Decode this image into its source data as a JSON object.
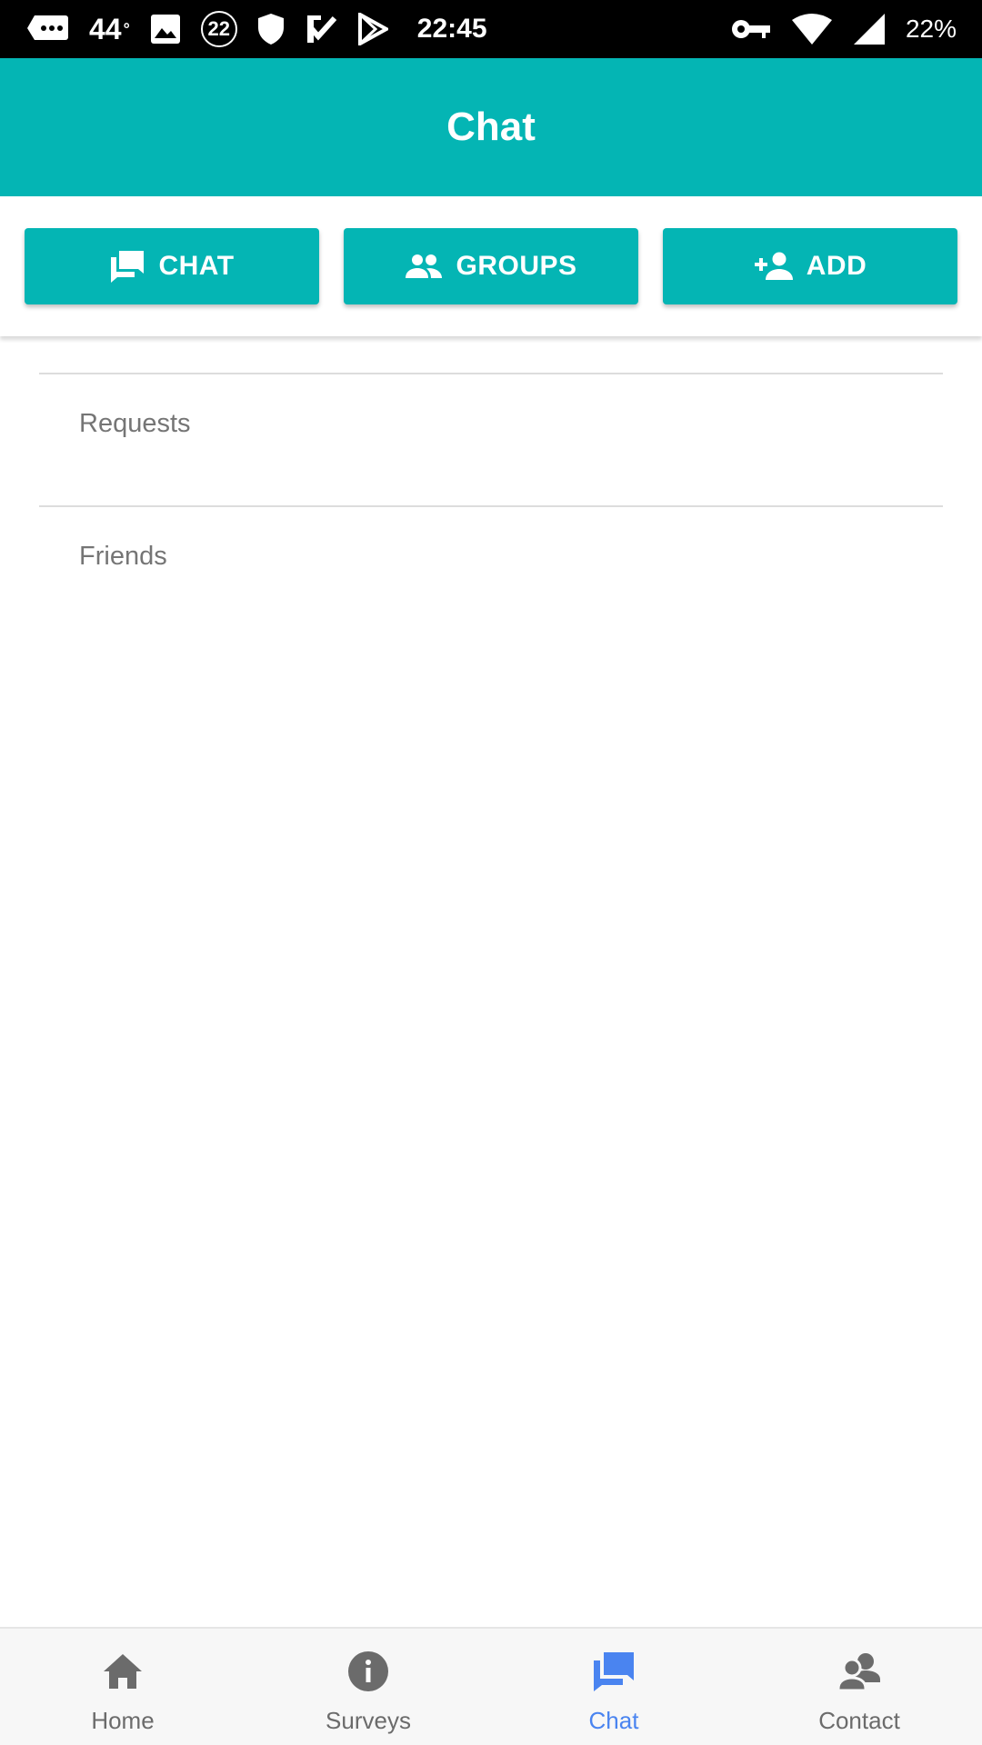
{
  "status_bar": {
    "temperature": "44",
    "temperature_unit": "°",
    "badge_number": "22",
    "time": "22:45",
    "battery": "22%"
  },
  "app_bar": {
    "title": "Chat"
  },
  "actions": [
    {
      "label": "CHAT",
      "icon": "chat-icon"
    },
    {
      "label": "GROUPS",
      "icon": "groups-icon"
    },
    {
      "label": "ADD",
      "icon": "add-person-icon"
    }
  ],
  "sections": [
    {
      "label": "Requests"
    },
    {
      "label": "Friends"
    }
  ],
  "bottom_nav": {
    "active": "Chat",
    "items": [
      {
        "label": "Home",
        "icon": "home-icon"
      },
      {
        "label": "Surveys",
        "icon": "info-icon"
      },
      {
        "label": "Chat",
        "icon": "chat-bubble-icon"
      },
      {
        "label": "Contact",
        "icon": "contact-icon"
      }
    ]
  },
  "colors": {
    "primary": "#04b5b4",
    "active_nav": "#4a84f0",
    "inactive_nav": "#6b6b6b",
    "section_text": "#757575"
  }
}
